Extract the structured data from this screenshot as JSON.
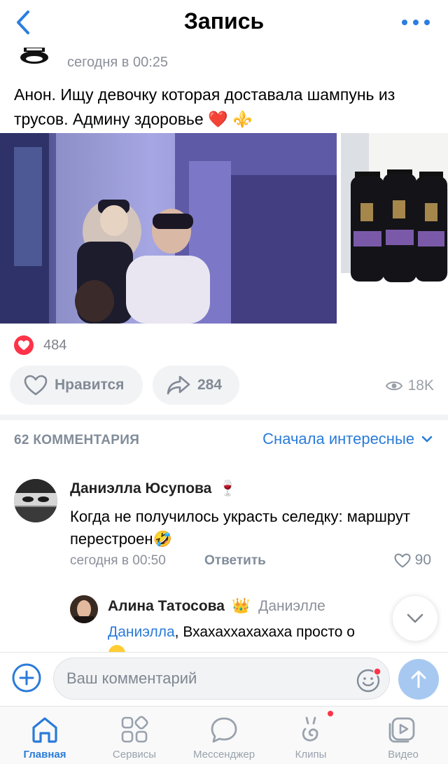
{
  "header": {
    "title": "Запись",
    "back_icon": "chevron-left-icon",
    "more_icon": "more-horizontal-icon"
  },
  "post": {
    "time": "сегодня в 00:25",
    "text": "Анон. Ищу девочку которая доставала шампунь из трусов. Админу здоровье ❤️ ⚜️",
    "likes_count": "484",
    "like_button": "Нравится",
    "shares_count": "284",
    "views_count": "18K"
  },
  "comments": {
    "count_label": "62 КОММЕНТАРИЯ",
    "sort_label": "Сначала интересные",
    "items": [
      {
        "author": "Даниэлла Юсупова",
        "author_emoji": "🍷",
        "text": "Когда не получилось украсть селедку: маршрут перестроен🤣",
        "time": "сегодня в 00:50",
        "reply_label": "Ответить",
        "likes": "90"
      },
      {
        "author": "Алина Татосова",
        "author_emoji": "👑",
        "reply_to": "Даниэлле",
        "mention": "Даниэлла",
        "text": ", Вхахаххахахаха просто о"
      }
    ]
  },
  "composer": {
    "placeholder": "Ваш комментарий"
  },
  "tabbar": {
    "items": [
      {
        "label": "Главная",
        "icon": "home-icon",
        "active": true
      },
      {
        "label": "Сервисы",
        "icon": "services-icon"
      },
      {
        "label": "Мессенджер",
        "icon": "messenger-icon"
      },
      {
        "label": "Клипы",
        "icon": "clips-icon",
        "badge": true
      },
      {
        "label": "Видео",
        "icon": "video-icon"
      }
    ]
  },
  "colors": {
    "accent": "#2a7bd9",
    "like_red": "#ff3347",
    "muted": "#818c99"
  }
}
